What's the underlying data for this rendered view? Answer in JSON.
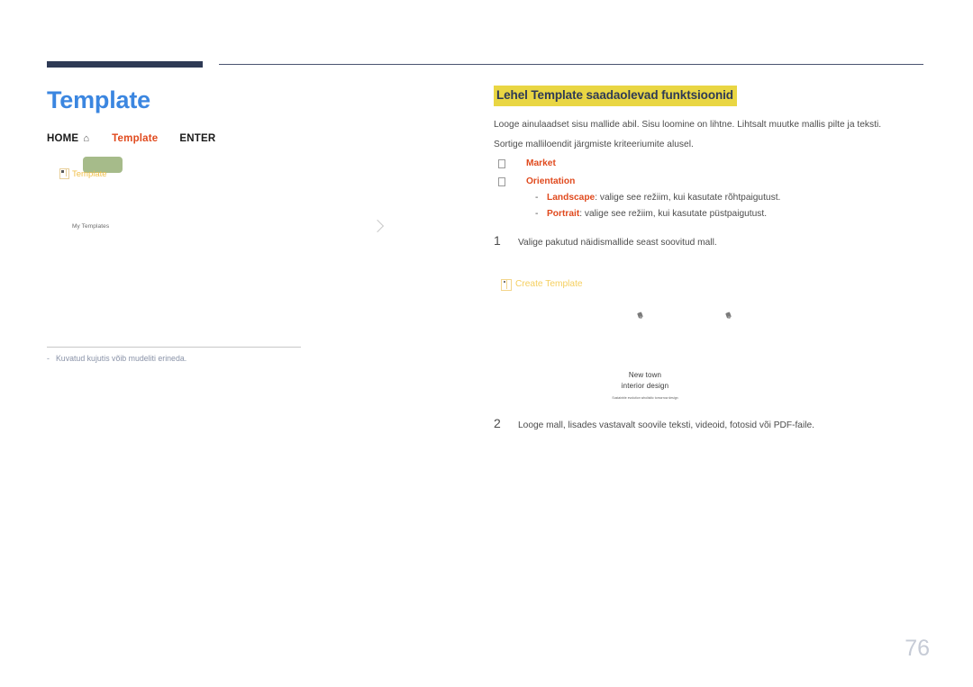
{
  "page": {
    "title": "Template",
    "number": "76",
    "accent_blue": "#3b86e0",
    "highlight_yellow": "#e9d643",
    "accent_orange": "#e04a1e",
    "rule_navy": "#2e3a55"
  },
  "breadcrumb": {
    "home_label": "HOME",
    "home_icon": "home-icon",
    "template_label": "Template",
    "enter_label": "ENTER"
  },
  "device_mock": {
    "tab_icon": "template-doc-icon",
    "tab_label": "Template",
    "chip_color": "#a6bb8a",
    "list_label": "My Templates",
    "chevron_icon": "chevron-right-icon"
  },
  "footnote": {
    "dash": "-",
    "text": "Kuvatud kujutis võib mudeliti erineda."
  },
  "content": {
    "heading": "Lehel Template saadaolevad funktsioonid",
    "intro_1": "Looge ainulaadset sisu mallide abil. Sisu loomine on lihtne. Lihtsalt muutke mallis pilte ja teksti.",
    "intro_2": "Sortige malliloendit järgmiste kriteeriumite alusel.",
    "bullets": [
      {
        "label": "Market"
      },
      {
        "label": "Orientation"
      }
    ],
    "sub_items": [
      {
        "dash": "-",
        "term": "Landscape",
        "rest": ": valige see režiim, kui kasutate rõhtpaigutust."
      },
      {
        "dash": "-",
        "term": "Portrait",
        "rest": ": valige see režiim, kui kasutate püstpaigutust."
      }
    ],
    "steps": [
      {
        "num": "1",
        "text": "Valige pakutud näidismallide seast soovitud mall."
      },
      {
        "num": "2",
        "text": "Looge mall, lisades vastavalt soovile teksti, videoid, fotosid või PDF-faile."
      }
    ]
  },
  "create_template": {
    "icon": "create-template-icon",
    "label": "Create Template"
  },
  "preview": {
    "title_line_1": "New town",
    "title_line_2": "interior design",
    "caption": "Sustainble evolution wholisitic tomorrow design",
    "pin_icon": "pin-icon"
  }
}
